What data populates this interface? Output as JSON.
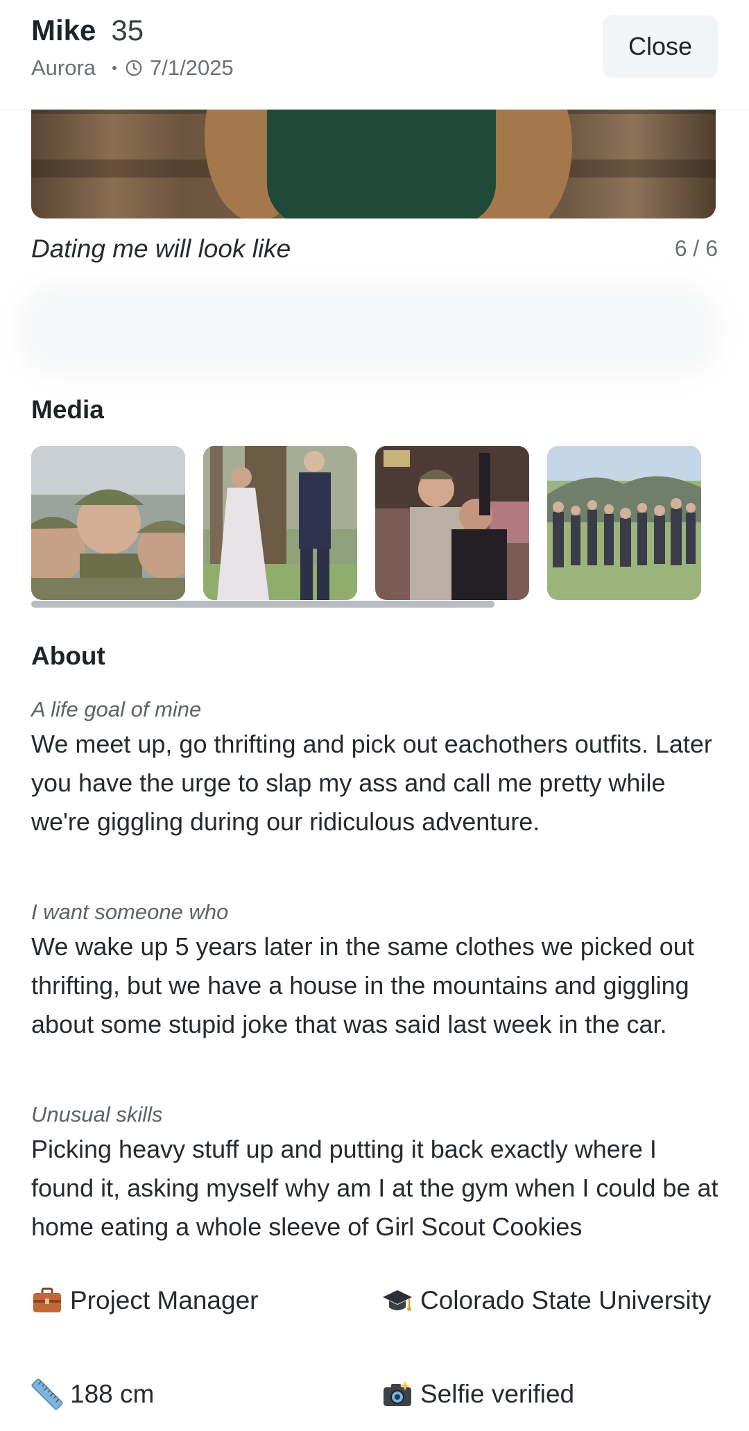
{
  "header": {
    "name": "Mike",
    "age": "35",
    "location": "Aurora",
    "date": "7/1/2025",
    "close_label": "Close"
  },
  "photo": {
    "caption": "Dating me will look like",
    "counter": "6 / 6"
  },
  "media": {
    "title": "Media",
    "thumbnails": [
      {
        "icon": "photo-three-men-hats"
      },
      {
        "icon": "photo-couple-forest"
      },
      {
        "icon": "photo-two-men-bar"
      },
      {
        "icon": "photo-group-mountains"
      }
    ],
    "scroll_fraction": 0.68
  },
  "about": {
    "title": "About",
    "prompts": [
      {
        "label": "A life goal of mine",
        "answer": "We meet up, go thrifting and pick out eachothers outfits. Later you have the urge to slap my ass and call me pretty while we're giggling during our ridiculous adventure."
      },
      {
        "label": "I want someone who",
        "answer": "We wake up 5 years later in the same clothes we picked out thrifting, but we have a house in the mountains and giggling about some stupid joke that was said last week in the car."
      },
      {
        "label": "Unusual skills",
        "answer": "Picking heavy stuff up and putting it back exactly where I found it, asking myself why am I at the gym when I could be at home eating a whole sleeve of Girl Scout Cookies"
      }
    ]
  },
  "facts": [
    {
      "icon": "briefcase-icon",
      "text": "Project Manager"
    },
    {
      "icon": "graduation-cap-icon",
      "text": "Colorado State University"
    },
    {
      "icon": "ruler-icon",
      "text": "188 cm"
    },
    {
      "icon": "camera-icon",
      "text": "Selfie verified"
    }
  ],
  "colors": {
    "text": "#1f2328",
    "muted": "#6b7076",
    "button_bg": "#f3f4f6",
    "scrollbar": "#b9bcc0"
  }
}
